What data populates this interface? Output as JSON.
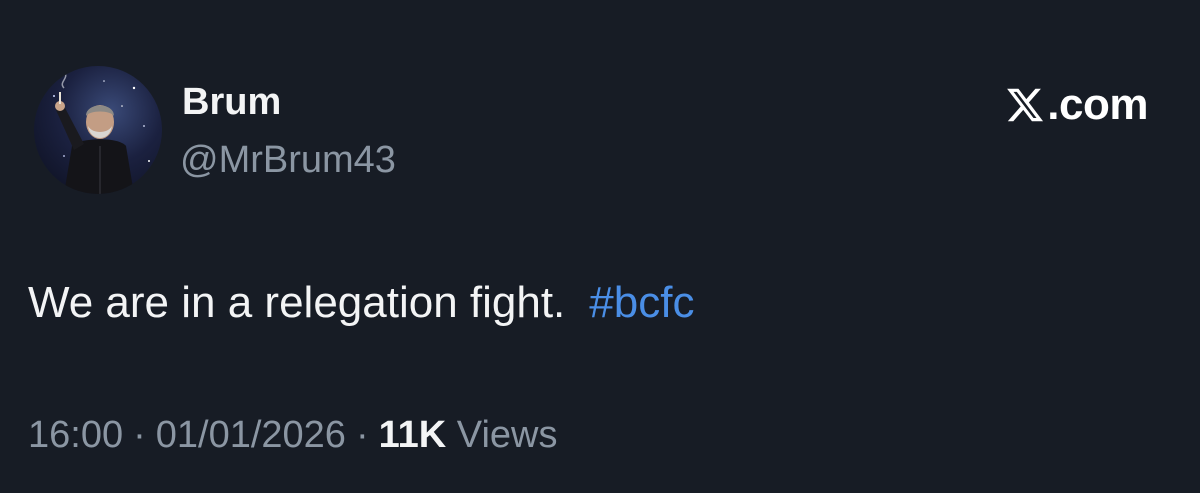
{
  "tweet": {
    "author": {
      "display_name": "Brum",
      "handle": "@MrBrum43"
    },
    "brand": {
      "icon": "x-logo-icon",
      "suffix": ".com"
    },
    "text": "We are in a relegation fight.",
    "hashtag": "#bcfc",
    "meta": {
      "time": "16:00",
      "separator": "·",
      "date": "01/01/2026",
      "views_count": "11K",
      "views_label": "Views"
    }
  },
  "colors": {
    "background": "#171c25",
    "primary_text": "#f3f4f5",
    "secondary_text": "#8b96a3",
    "hashtag": "#4a8ee6"
  }
}
